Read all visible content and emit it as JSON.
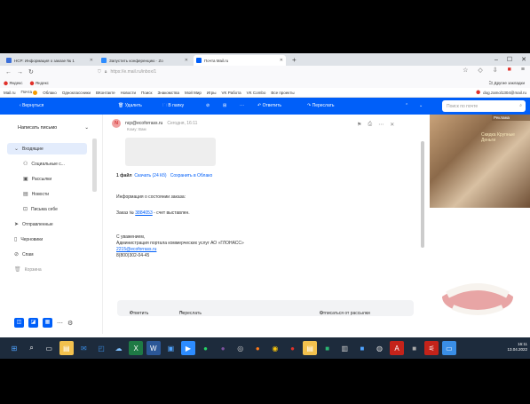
{
  "browser": {
    "tabs": [
      {
        "label": "НСР: Информация о заказе № 1",
        "color": "#3b6fd9"
      },
      {
        "label": "Запустить конференцию · Zo",
        "color": "#2d8cff"
      },
      {
        "label": "Почта Mail.ru",
        "color": "#005ff9"
      }
    ],
    "url": "https://e.mail.ru/inbox/1",
    "bookmarks": [
      "Яндекс",
      "Яндекс"
    ],
    "bookmarks_right": "Другие закладки",
    "window_controls": [
      "–",
      "☐",
      "✕"
    ]
  },
  "portal": {
    "links": [
      "Mail.ru",
      "Почта",
      "Облако",
      "Одноклассники",
      "ВКонтакте",
      "Новости",
      "Поиск",
      "Знакомства",
      "Мой Мир",
      "Игры",
      "VK Работа",
      "VK Combo",
      "Все проекты"
    ],
    "account": "dog.zamol1304@mail.ru"
  },
  "toolbar": {
    "back": "Вернуться",
    "delete": "Удалить",
    "to_folder": "В папку",
    "reply": "Ответить",
    "forward": "Переслать",
    "search_placeholder": "Поиск по почте"
  },
  "sidebar": {
    "compose": "Написать письмо",
    "items": [
      {
        "label": "Входящие",
        "icon": "inbox-icon"
      },
      {
        "label": "Социальные с...",
        "icon": "social-icon"
      },
      {
        "label": "Рассылки",
        "icon": "newsletter-icon"
      },
      {
        "label": "Новости",
        "icon": "news-icon"
      },
      {
        "label": "Письма себе",
        "icon": "self-mail-icon"
      },
      {
        "label": "Отправленные",
        "icon": "sent-icon"
      },
      {
        "label": "Черновики",
        "icon": "drafts-icon"
      },
      {
        "label": "Спам",
        "icon": "spam-icon"
      },
      {
        "label": "Корзина",
        "icon": "trash-icon"
      }
    ]
  },
  "message": {
    "avatar": "N",
    "sender": "ncp@ecoforrass.ru",
    "date": "Сегодня, 16:11",
    "to_line": "Кому: Вам",
    "files": "1 файл",
    "download": "Скачать (24 Кб)",
    "save_cloud": "Сохранить в Облако",
    "line1": "Информация о состоянии заказа:",
    "order_prefix": "Заказ №",
    "order_number": "3884053",
    "order_suffix": "- счет выставлен.",
    "regards": "С уважением,",
    "org": "Администрация портала коммерческих услуг АО «ГЛОНАСС»",
    "email_link": "2215@ecoforrass.ru",
    "phone": "8(800)302-04-45"
  },
  "actions": {
    "reply": "Ответить",
    "forward": "Переслать",
    "unsubscribe": "Отписаться от рассылки"
  },
  "ads": {
    "ad1_label": "Реклама",
    "ad1_text": "Скидка Крупные Деньги"
  },
  "taskbar": {
    "time": "16:11",
    "date": "13.04.2022"
  }
}
